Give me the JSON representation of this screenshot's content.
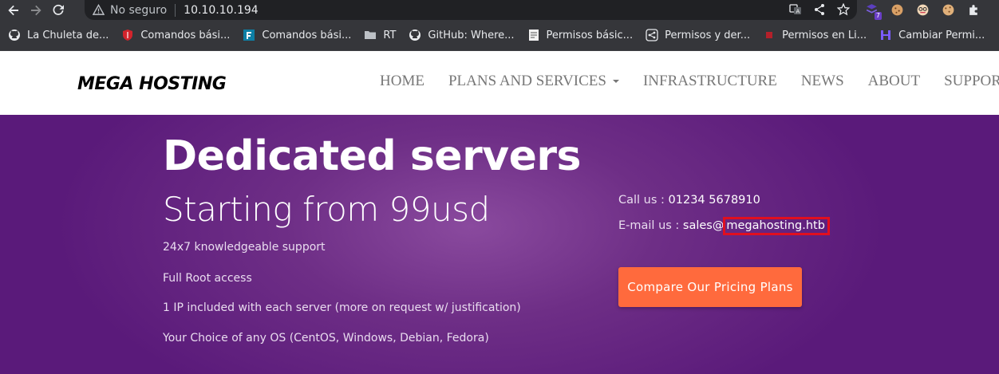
{
  "browser": {
    "security_label": "No seguro",
    "url": "10.10.10.194",
    "extension_badge": "7"
  },
  "bookmarks": [
    {
      "label": "La Chuleta de...",
      "icon": "github-icon"
    },
    {
      "label": "Comandos bási...",
      "icon": "shield-red-icon"
    },
    {
      "label": "Comandos bási...",
      "icon": "f-logo-icon"
    },
    {
      "label": "RT",
      "icon": "folder-icon"
    },
    {
      "label": "GitHub: Where...",
      "icon": "github-icon"
    },
    {
      "label": "Permisos básic...",
      "icon": "page-icon"
    },
    {
      "label": "Permisos y der...",
      "icon": "share-icon"
    },
    {
      "label": "Permisos en Li...",
      "icon": "red-dot-icon"
    },
    {
      "label": "Cambiar Permi...",
      "icon": "h-logo-icon"
    }
  ],
  "site": {
    "logo": "MEGA HOSTING",
    "nav": [
      "HOME",
      "PLANS AND SERVICES",
      "INFRASTRUCTURE",
      "NEWS",
      "ABOUT",
      "SUPPORT"
    ]
  },
  "hero": {
    "title": "Dedicated servers",
    "subtitle": "Starting from 99usd",
    "features": [
      "24x7 knowledgeable support",
      "Full Root access",
      "1 IP included with each server (more on request w/ justification)",
      "Your Choice of any OS (CentOS, Windows, Debian, Fedora)"
    ],
    "call_label": "Call us :",
    "phone": "01234 5678910",
    "email_label": "E-mail us :",
    "email_user": "sales@",
    "email_domain": "megahosting.htb",
    "cta_label": "Compare Our Pricing Plans"
  },
  "colors": {
    "hero_purple": "#6e2e86",
    "cta_orange": "#ff6a3d",
    "highlight_red": "#e10f1f"
  }
}
